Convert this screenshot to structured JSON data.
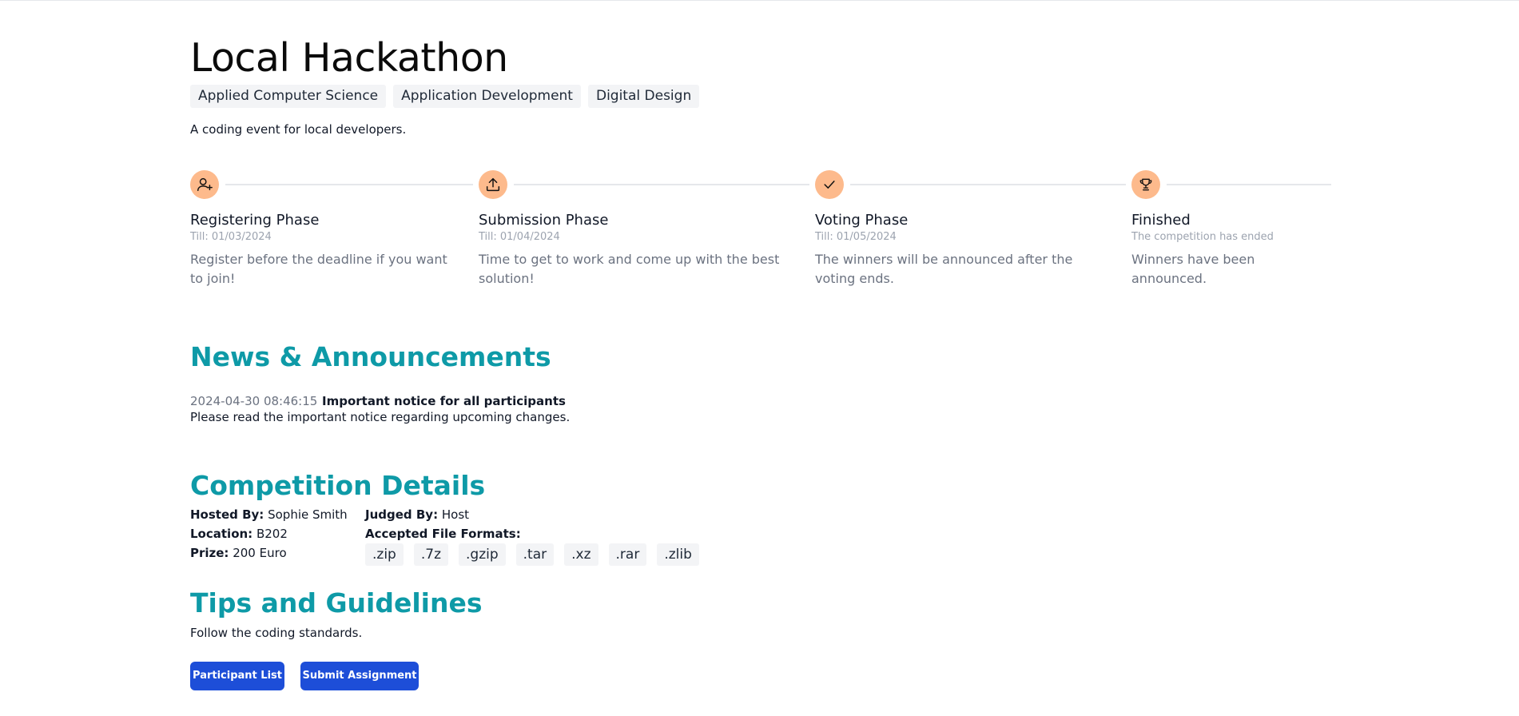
{
  "competition": {
    "title": "Local Hackathon",
    "tags": [
      "Applied Computer Science",
      "Application Development",
      "Digital Design"
    ],
    "description": "A coding event for local developers."
  },
  "phases": [
    {
      "icon": "user-plus-icon",
      "name": "Registering Phase",
      "till": "Till: 01/03/2024",
      "text": "Register before the deadline if you want to join!"
    },
    {
      "icon": "upload-icon",
      "name": "Submission Phase",
      "till": "Till: 01/04/2024",
      "text": "Time to get to work and come up with the best solution!"
    },
    {
      "icon": "check-icon",
      "name": "Voting Phase",
      "till": "Till: 01/05/2024",
      "text": "The winners will be announced after the voting ends."
    },
    {
      "icon": "trophy-icon",
      "name": "Finished",
      "till": "The competition has ended",
      "text": "Winners have been announced."
    }
  ],
  "news": {
    "heading": "News & Announcements",
    "items": [
      {
        "date": "2024-04-30 08:46:15",
        "title": "Important notice for all participants",
        "body": "Please read the important notice regarding upcoming changes."
      }
    ]
  },
  "details": {
    "heading": "Competition Details",
    "hosted_by_label": "Hosted By:",
    "hosted_by": "Sophie Smith",
    "location_label": "Location:",
    "location": "B202",
    "prize_label": "Prize:",
    "prize": "200 Euro",
    "judged_by_label": "Judged By:",
    "judged_by": "Host",
    "formats_label": "Accepted File Formats:",
    "formats": [
      ".zip",
      ".7z",
      ".gzip",
      ".tar",
      ".xz",
      ".rar",
      ".zlib"
    ]
  },
  "tips": {
    "heading": "Tips and Guidelines",
    "text": "Follow the coding standards."
  },
  "actions": {
    "participants_label": "Participant List",
    "submit_label": "Submit Assignment"
  },
  "colors": {
    "accent": "#0e9aa7",
    "phase_icon_bg": "#fdba8c",
    "button": "#1d4ed8"
  }
}
